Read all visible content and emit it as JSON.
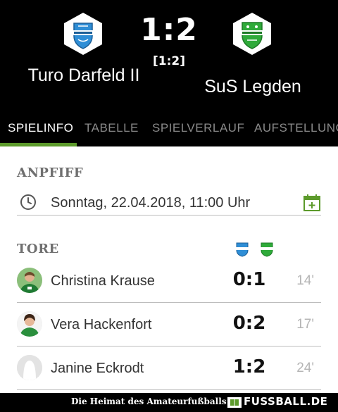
{
  "match": {
    "home_team": "Turo Darfeld II",
    "away_team": "SuS Legden",
    "score": "1:2",
    "halftime": "[1:2]"
  },
  "tabs": [
    "SPIELINFO",
    "TABELLE",
    "SPIELVERLAUF",
    "AUFSTELLUNG"
  ],
  "active_tab": "SPIELINFO",
  "kickoff": {
    "title": "ANPFIFF",
    "datetime": "Sonntag, 22.04.2018, 11:00 Uhr"
  },
  "goals": {
    "title": "TORE",
    "items": [
      {
        "player": "Christina Krause",
        "score": "0:1",
        "minute": "14'"
      },
      {
        "player": "Vera Hackenfort",
        "score": "0:2",
        "minute": "17'"
      },
      {
        "player": "Janine Eckrodt",
        "score": "1:2",
        "minute": "24'"
      }
    ]
  },
  "footer": {
    "tagline": "Die Heimat des Amateurfußballs",
    "brand": "FUSSBALL.DE"
  },
  "icons": {
    "clock": "clock-icon",
    "calendar": "calendar-add-icon",
    "home_crest": "turo-darfeld-crest",
    "away_crest": "sus-legden-crest"
  },
  "colors": {
    "accent_green": "#5c9a2b",
    "home_blue": "#2f8ed6",
    "away_green": "#2faa3a",
    "header_bg": "#000000"
  }
}
